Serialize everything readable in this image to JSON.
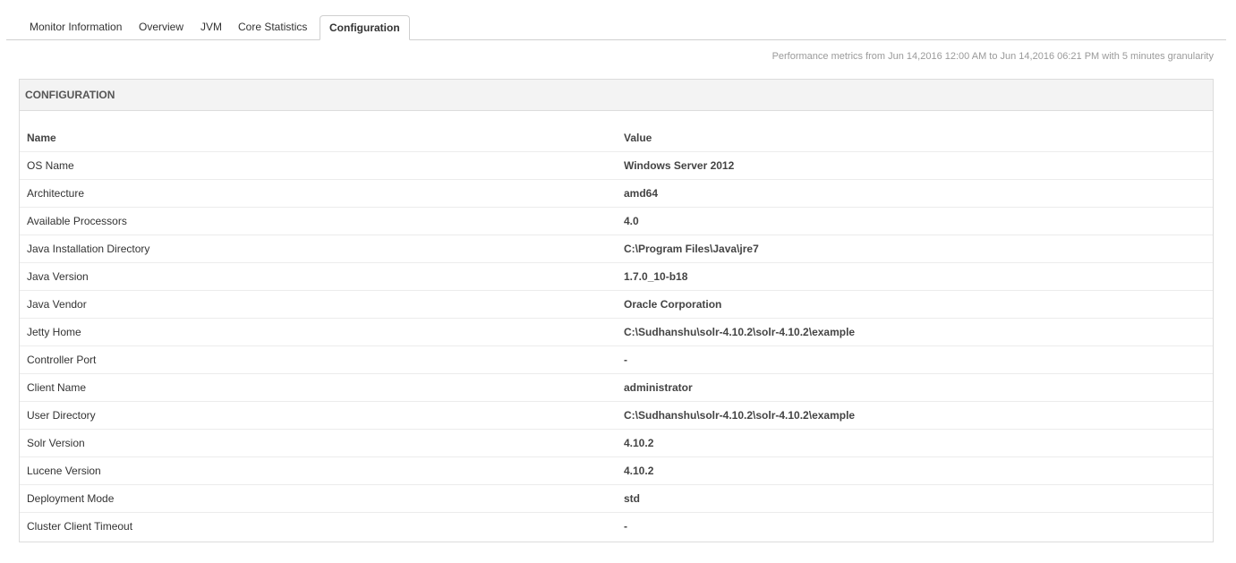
{
  "tabs": [
    {
      "label": "Monitor Information",
      "active": false
    },
    {
      "label": "Overview",
      "active": false
    },
    {
      "label": "JVM",
      "active": false
    },
    {
      "label": "Core Statistics",
      "active": false
    },
    {
      "label": "Configuration",
      "active": true
    }
  ],
  "perf_note": "Performance metrics from Jun 14,2016 12:00 AM to Jun 14,2016 06:21 PM with 5 minutes granularity",
  "panel": {
    "title": "CONFIGURATION",
    "columns": {
      "name": "Name",
      "value": "Value"
    },
    "rows": [
      {
        "name": "OS Name",
        "value": "Windows Server 2012"
      },
      {
        "name": "Architecture",
        "value": "amd64"
      },
      {
        "name": "Available Processors",
        "value": "4.0"
      },
      {
        "name": "Java Installation Directory",
        "value": "C:\\Program Files\\Java\\jre7"
      },
      {
        "name": "Java Version",
        "value": "1.7.0_10-b18"
      },
      {
        "name": "Java Vendor",
        "value": "Oracle Corporation"
      },
      {
        "name": "Jetty Home",
        "value": "C:\\Sudhanshu\\solr-4.10.2\\solr-4.10.2\\example"
      },
      {
        "name": "Controller Port",
        "value": "-"
      },
      {
        "name": "Client Name",
        "value": "administrator"
      },
      {
        "name": "User Directory",
        "value": "C:\\Sudhanshu\\solr-4.10.2\\solr-4.10.2\\example"
      },
      {
        "name": "Solr Version",
        "value": "4.10.2"
      },
      {
        "name": "Lucene Version",
        "value": "4.10.2"
      },
      {
        "name": "Deployment Mode",
        "value": "std"
      },
      {
        "name": "Cluster Client Timeout",
        "value": "-"
      }
    ]
  }
}
